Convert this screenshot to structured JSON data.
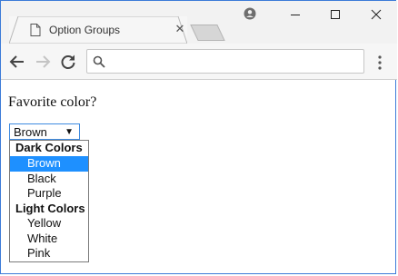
{
  "browser": {
    "tab_title": "Option Groups",
    "address_value": ""
  },
  "page": {
    "question": "Favorite color?",
    "select_value": "Brown",
    "groups": [
      {
        "label": "Dark Colors",
        "options": [
          "Brown",
          "Black",
          "Purple"
        ]
      },
      {
        "label": "Light Colors",
        "options": [
          "Yellow",
          "White",
          "Pink"
        ]
      }
    ],
    "highlighted_option": "Brown"
  },
  "colors": {
    "selection": "#1e90ff",
    "select_border": "#3f8be0",
    "window_border": "#3c7bd8"
  }
}
